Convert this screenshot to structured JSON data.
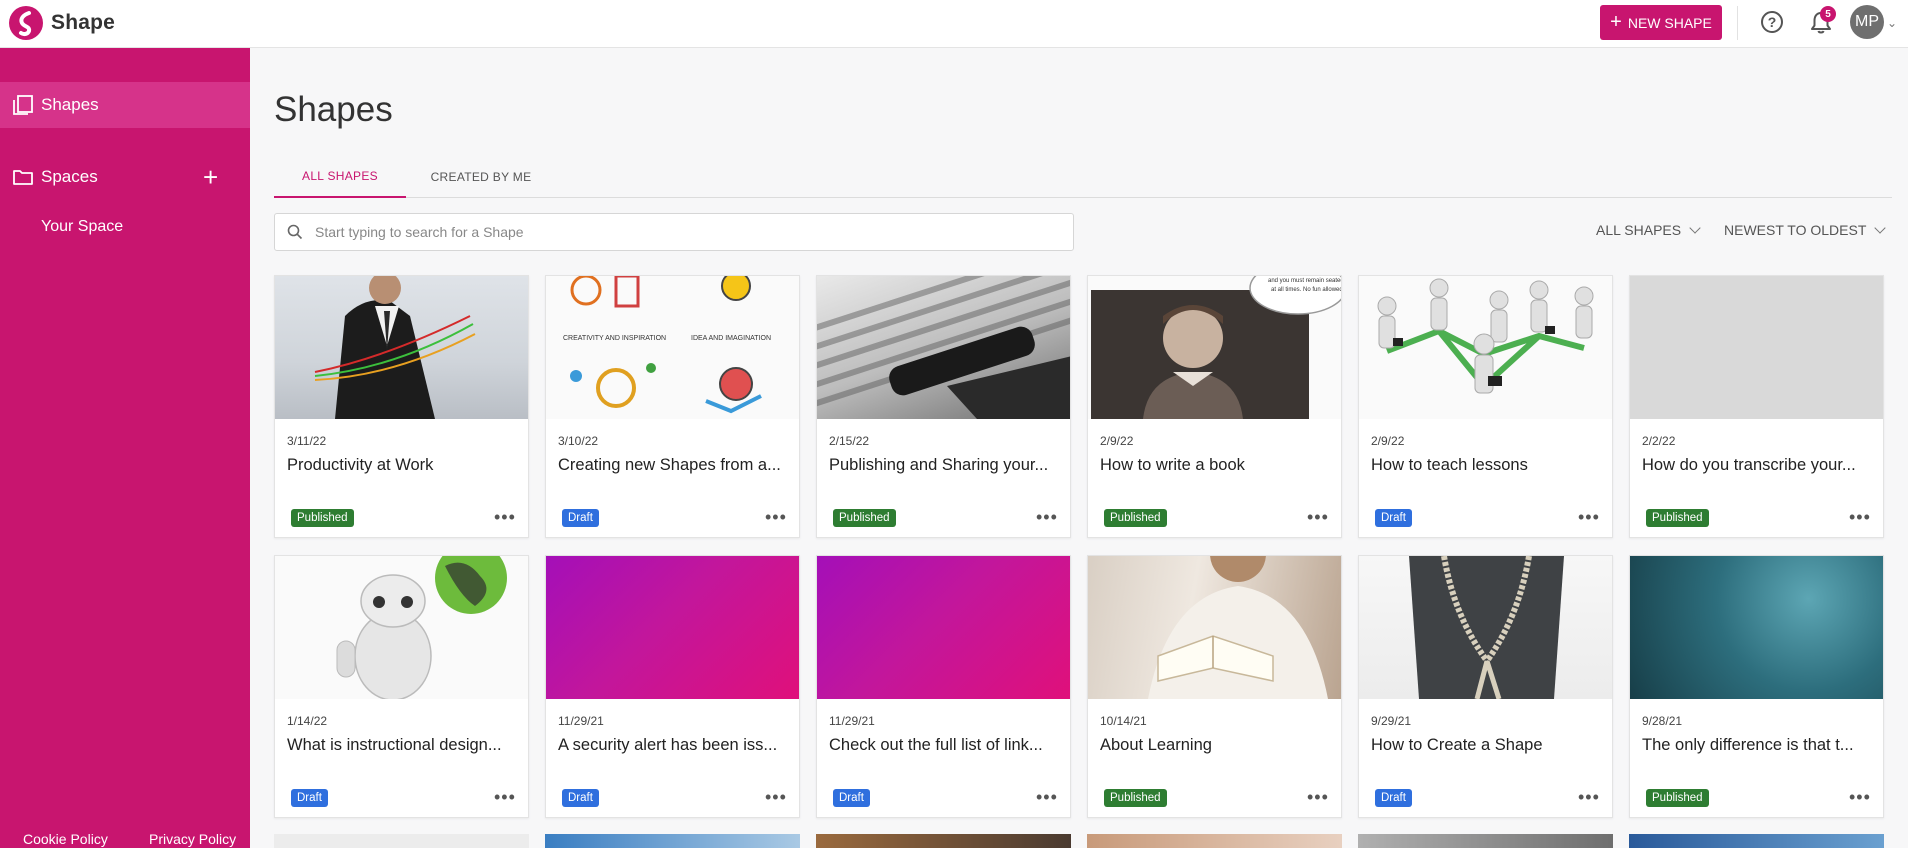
{
  "app": {
    "name": "Shape"
  },
  "header": {
    "new_shape_label": "NEW SHAPE",
    "notification_count": "5",
    "avatar_initials": "MP"
  },
  "sidebar": {
    "shapes_label": "Shapes",
    "spaces_label": "Spaces",
    "your_space_label": "Your Space",
    "footer": {
      "cookie_policy": "Cookie Policy",
      "privacy_policy": "Privacy Policy"
    }
  },
  "main": {
    "title": "Shapes",
    "tabs": [
      {
        "label": "ALL SHAPES",
        "active": true
      },
      {
        "label": "CREATED BY ME",
        "active": false
      }
    ],
    "search": {
      "placeholder": "Start typing to search for a Shape",
      "value": ""
    },
    "filters": {
      "type": "ALL SHAPES",
      "sort": "NEWEST TO OLDEST"
    },
    "status_colors": {
      "Published": "#2e7d32",
      "Draft": "#2f6fde"
    },
    "cards": [
      {
        "date": "3/11/22",
        "title": "Productivity at Work",
        "status": "Published",
        "thumb": "office-man"
      },
      {
        "date": "3/10/22",
        "title": "Creating new Shapes from a...",
        "status": "Draft",
        "thumb": "creativity-icons"
      },
      {
        "date": "2/15/22",
        "title": "Publishing and Sharing your...",
        "status": "Published",
        "thumb": "typewriter"
      },
      {
        "date": "2/9/22",
        "title": "How to write a book",
        "status": "Published",
        "thumb": "boy-portrait"
      },
      {
        "date": "2/9/22",
        "title": "How to teach lessons",
        "status": "Draft",
        "thumb": "network-people"
      },
      {
        "date": "2/2/22",
        "title": "How do you transcribe your...",
        "status": "Published",
        "thumb": "blank-grey"
      },
      {
        "date": "1/14/22",
        "title": "What is instructional design...",
        "status": "Draft",
        "thumb": "robot-globe"
      },
      {
        "date": "11/29/21",
        "title": "A security alert has been iss...",
        "status": "Draft",
        "thumb": "magenta-gradient"
      },
      {
        "date": "11/29/21",
        "title": "Check out the full list of link...",
        "status": "Draft",
        "thumb": "magenta-gradient"
      },
      {
        "date": "10/14/21",
        "title": "About Learning",
        "status": "Published",
        "thumb": "woman-reading"
      },
      {
        "date": "9/29/21",
        "title": "How to Create a Shape",
        "status": "Draft",
        "thumb": "bag"
      },
      {
        "date": "9/28/21",
        "title": "The only difference is that t...",
        "status": "Published",
        "thumb": "teal-texture"
      }
    ]
  }
}
